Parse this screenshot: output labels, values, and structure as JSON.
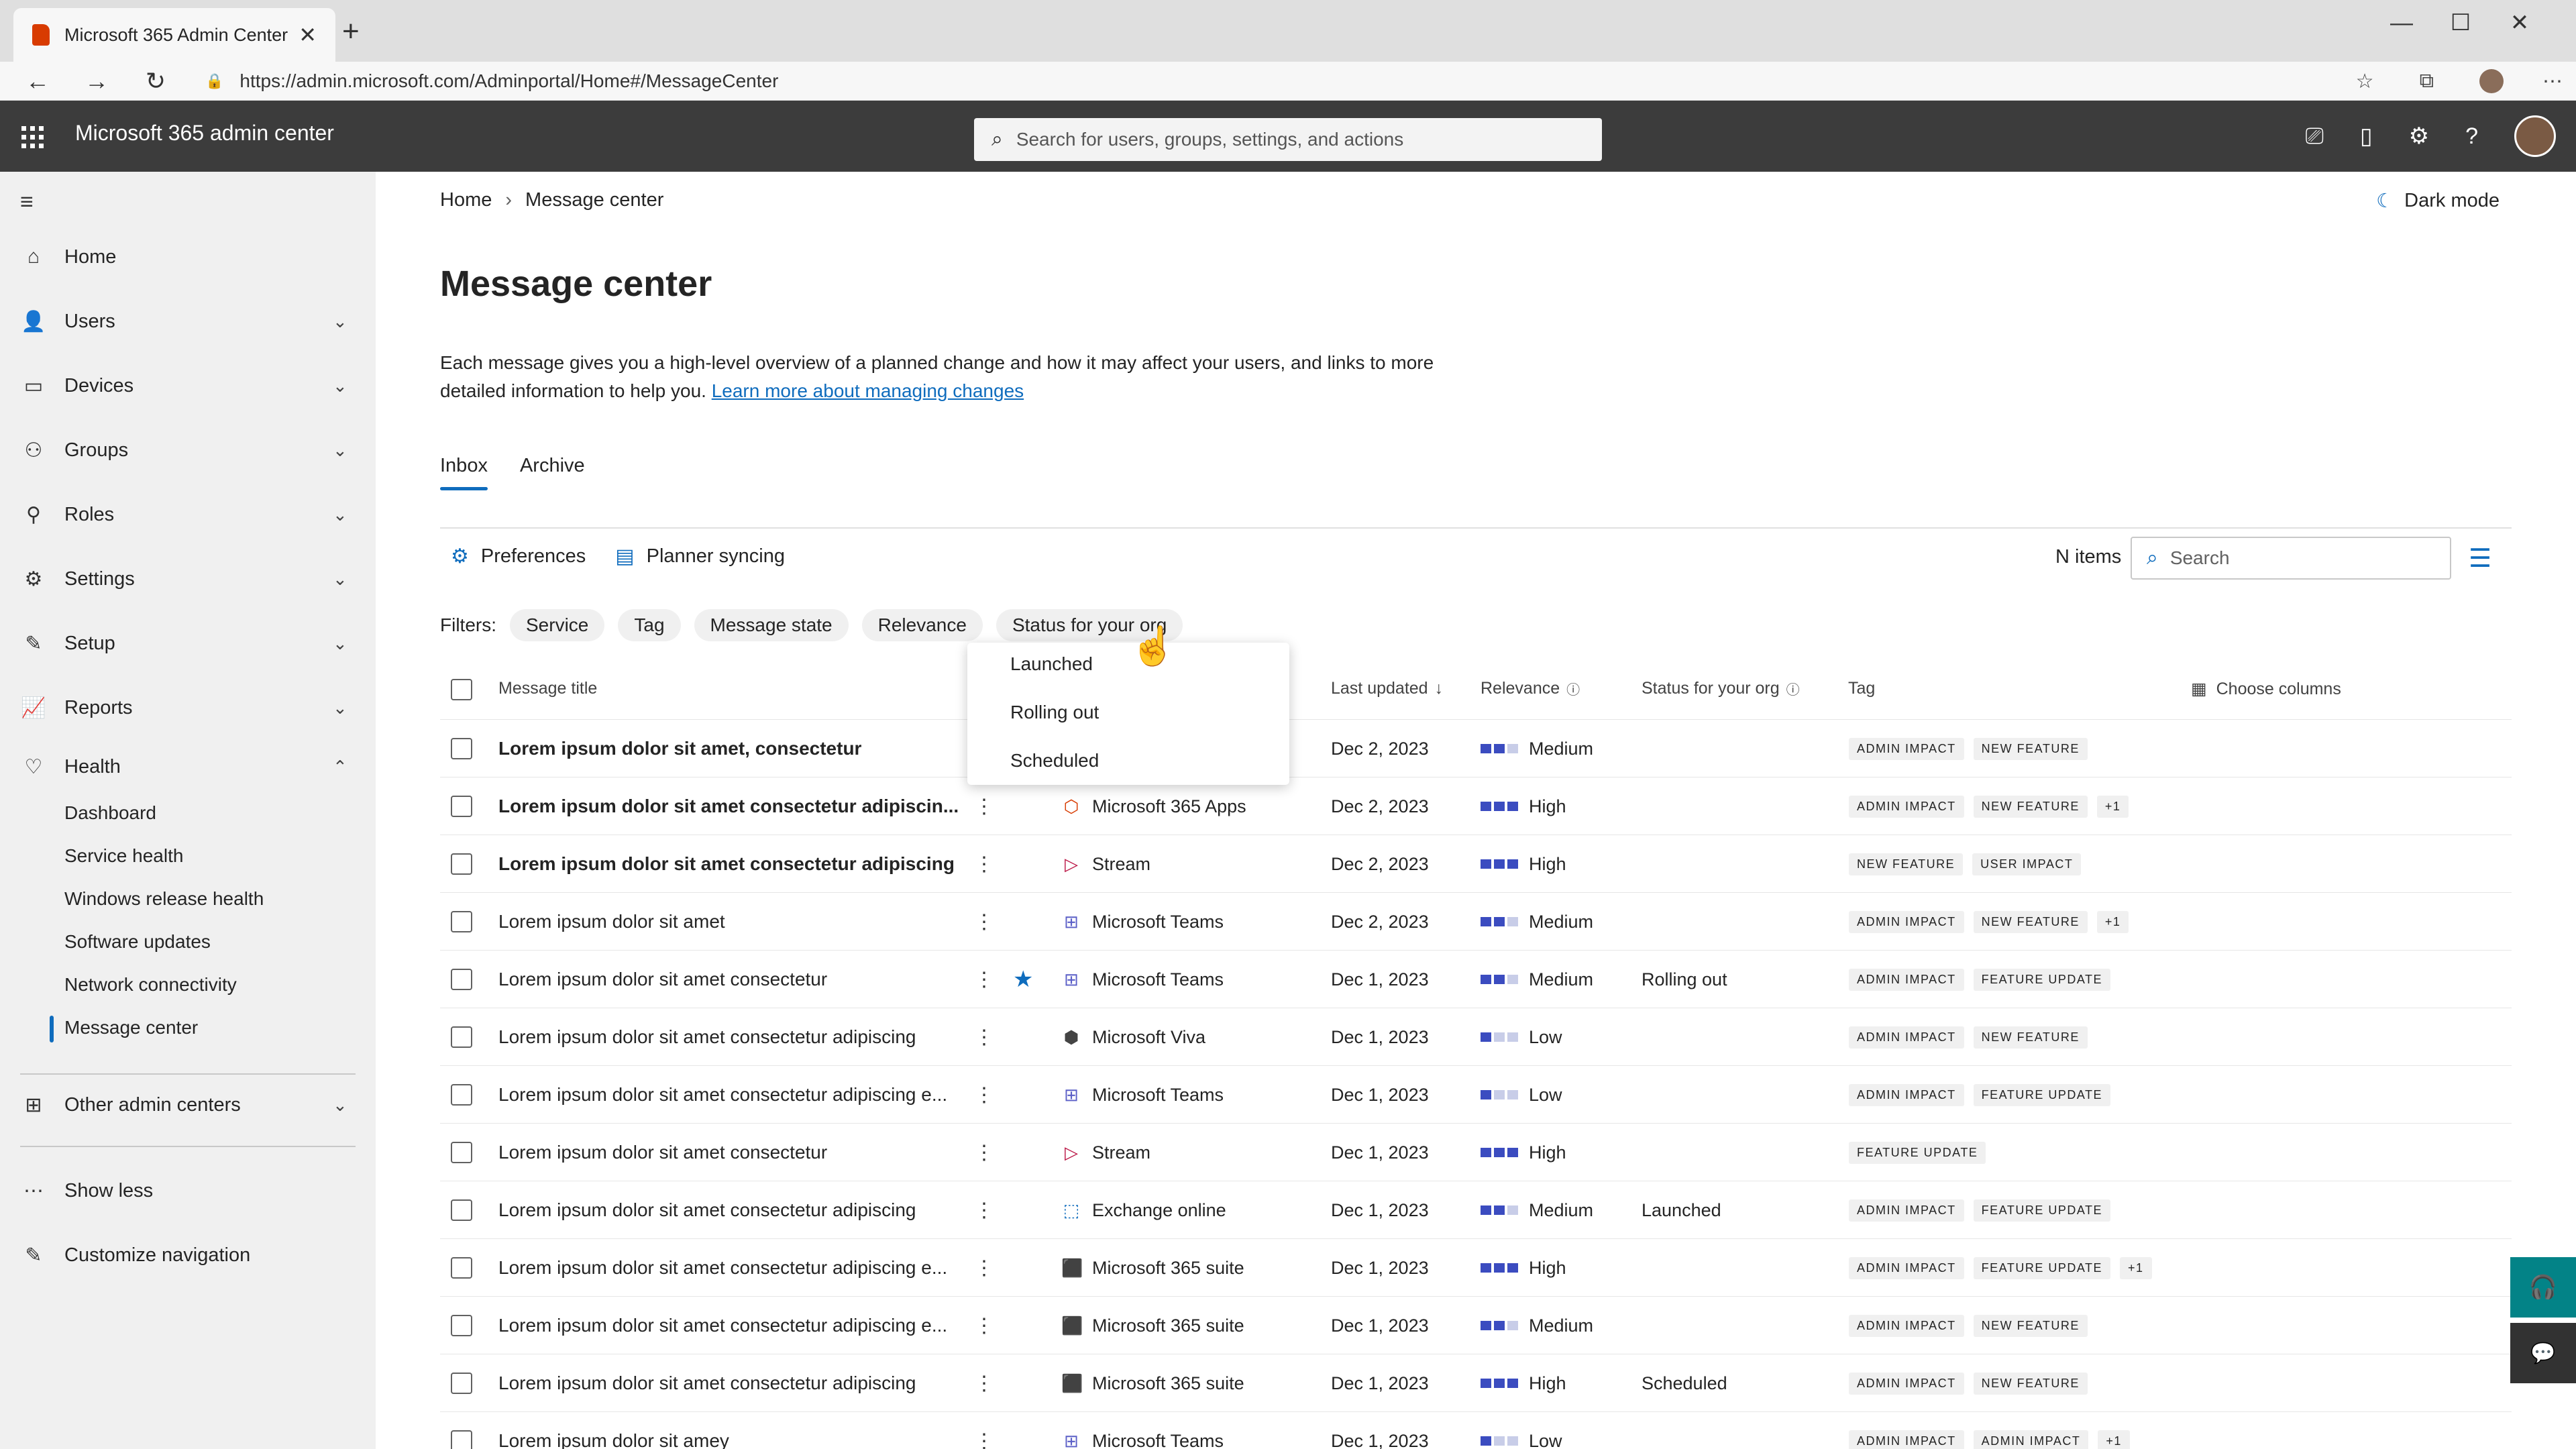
{
  "browser": {
    "tab_title": "Microsoft 365 Admin Center",
    "url": "https://admin.microsoft.com/Adminportal/Home#/MessageCenter"
  },
  "app": {
    "title": "Microsoft 365 admin center",
    "search_placeholder": "Search for users, groups, settings, and actions"
  },
  "sidebar": {
    "items": [
      {
        "label": "Home",
        "icon": "home-icon"
      },
      {
        "label": "Users",
        "icon": "user-icon"
      },
      {
        "label": "Devices",
        "icon": "device-icon"
      },
      {
        "label": "Groups",
        "icon": "groups-icon"
      },
      {
        "label": "Roles",
        "icon": "roles-icon"
      },
      {
        "label": "Settings",
        "icon": "gear-icon"
      },
      {
        "label": "Setup",
        "icon": "wrench-icon"
      },
      {
        "label": "Reports",
        "icon": "chart-icon"
      },
      {
        "label": "Health",
        "icon": "heart-icon"
      }
    ],
    "health_sub": [
      "Dashboard",
      "Service health",
      "Windows release health",
      "Software updates",
      "Network connectivity",
      "Message center"
    ],
    "other_admin": "Other admin centers",
    "show_less": "Show less",
    "customize": "Customize navigation"
  },
  "breadcrumb": {
    "home": "Home",
    "current": "Message center"
  },
  "dark_mode": "Dark mode",
  "page_title": "Message center",
  "description": "Each message gives you a high-level overview of a planned change and how it may affect your users, and links to more detailed information to help you.",
  "description_link": "Learn more about managing changes",
  "tabs": {
    "inbox": "Inbox",
    "archive": "Archive"
  },
  "toolbar": {
    "preferences": "Preferences",
    "planner": "Planner syncing",
    "count": "N items",
    "search_placeholder": "Search"
  },
  "filters": {
    "label": "Filters:",
    "chips": [
      "Service",
      "Tag",
      "Message state",
      "Relevance",
      "Status for your org"
    ]
  },
  "dropdown": [
    "Launched",
    "Rolling out",
    "Scheduled"
  ],
  "columns": {
    "title": "Message title",
    "updated": "Last updated",
    "relevance": "Relevance",
    "status": "Status for your org",
    "tag": "Tag",
    "choose": "Choose columns"
  },
  "colors": {
    "accent": "#0f6cbd",
    "rel_on": "#3b4cc0",
    "rel_off": "#c8cde8"
  },
  "rows": [
    {
      "title": "Lorem ipsum dolor sit amet, consectetur",
      "bold": true,
      "service": "",
      "svc_icon": "",
      "date": "Dec 2, 2023",
      "rel": "Medium",
      "level": 2,
      "status": "",
      "tags": [
        "ADMIN IMPACT",
        "NEW FEATURE"
      ],
      "star": false
    },
    {
      "title": "Lorem ipsum dolor sit amet consectetur adipiscin...",
      "bold": true,
      "service": "Microsoft 365 Apps",
      "svc_icon": "office-icon",
      "date": "Dec 2, 2023",
      "rel": "High",
      "level": 3,
      "status": "",
      "tags": [
        "ADMIN IMPACT",
        "NEW FEATURE",
        "+1"
      ],
      "star": false
    },
    {
      "title": "Lorem ipsum dolor sit amet consectetur adipiscing",
      "bold": true,
      "service": "Stream",
      "svc_icon": "stream-icon",
      "date": "Dec 2, 2023",
      "rel": "High",
      "level": 3,
      "status": "",
      "tags": [
        "NEW FEATURE",
        "USER IMPACT"
      ],
      "star": false
    },
    {
      "title": "Lorem ipsum dolor sit amet",
      "bold": false,
      "service": "Microsoft Teams",
      "svc_icon": "teams-icon",
      "date": "Dec 2, 2023",
      "rel": "Medium",
      "level": 2,
      "status": "",
      "tags": [
        "ADMIN IMPACT",
        "NEW FEATURE",
        "+1"
      ],
      "star": false
    },
    {
      "title": "Lorem ipsum dolor sit amet consectetur",
      "bold": false,
      "service": "Microsoft Teams",
      "svc_icon": "teams-icon",
      "date": "Dec 1, 2023",
      "rel": "Medium",
      "level": 2,
      "status": "Rolling out",
      "tags": [
        "ADMIN IMPACT",
        "FEATURE UPDATE"
      ],
      "star": true
    },
    {
      "title": "Lorem ipsum dolor sit amet consectetur adipiscing",
      "bold": false,
      "service": "Microsoft Viva",
      "svc_icon": "viva-icon",
      "date": "Dec 1, 2023",
      "rel": "Low",
      "level": 1,
      "status": "",
      "tags": [
        "ADMIN IMPACT",
        "NEW FEATURE"
      ],
      "star": false
    },
    {
      "title": "Lorem ipsum dolor sit amet consectetur adipiscing e...",
      "bold": false,
      "service": "Microsoft Teams",
      "svc_icon": "teams-icon",
      "date": "Dec 1, 2023",
      "rel": "Low",
      "level": 1,
      "status": "",
      "tags": [
        "ADMIN IMPACT",
        "FEATURE UPDATE"
      ],
      "star": false
    },
    {
      "title": "Lorem ipsum dolor sit amet consectetur",
      "bold": false,
      "service": "Stream",
      "svc_icon": "stream-icon",
      "date": "Dec 1, 2023",
      "rel": "High",
      "level": 3,
      "status": "",
      "tags": [
        "FEATURE UPDATE"
      ],
      "star": false
    },
    {
      "title": "Lorem ipsum dolor sit amet consectetur adipiscing",
      "bold": false,
      "service": "Exchange online",
      "svc_icon": "exchange-icon",
      "date": "Dec 1, 2023",
      "rel": "Medium",
      "level": 2,
      "status": "Launched",
      "tags": [
        "ADMIN IMPACT",
        "FEATURE UPDATE"
      ],
      "star": false
    },
    {
      "title": "Lorem ipsum dolor sit amet consectetur adipiscing e...",
      "bold": false,
      "service": "Microsoft 365 suite",
      "svc_icon": "m365-icon",
      "date": "Dec 1, 2023",
      "rel": "High",
      "level": 3,
      "status": "",
      "tags": [
        "ADMIN IMPACT",
        "FEATURE UPDATE",
        "+1"
      ],
      "star": false
    },
    {
      "title": "Lorem ipsum dolor sit amet consectetur adipiscing e...",
      "bold": false,
      "service": "Microsoft 365 suite",
      "svc_icon": "m365-icon",
      "date": "Dec 1, 2023",
      "rel": "Medium",
      "level": 2,
      "status": "",
      "tags": [
        "ADMIN IMPACT",
        "NEW FEATURE"
      ],
      "star": false
    },
    {
      "title": "Lorem ipsum dolor sit amet consectetur adipiscing",
      "bold": false,
      "service": "Microsoft 365 suite",
      "svc_icon": "m365-icon",
      "date": "Dec 1, 2023",
      "rel": "High",
      "level": 3,
      "status": "Scheduled",
      "tags": [
        "ADMIN IMPACT",
        "NEW FEATURE"
      ],
      "star": false
    },
    {
      "title": "Lorem ipsum dolor sit amey",
      "bold": false,
      "service": "Microsoft Teams",
      "svc_icon": "teams-icon",
      "date": "Dec 1, 2023",
      "rel": "Low",
      "level": 1,
      "status": "",
      "tags": [
        "ADMIN IMPACT",
        "ADMIN IMPACT",
        "+1"
      ],
      "star": false
    }
  ]
}
